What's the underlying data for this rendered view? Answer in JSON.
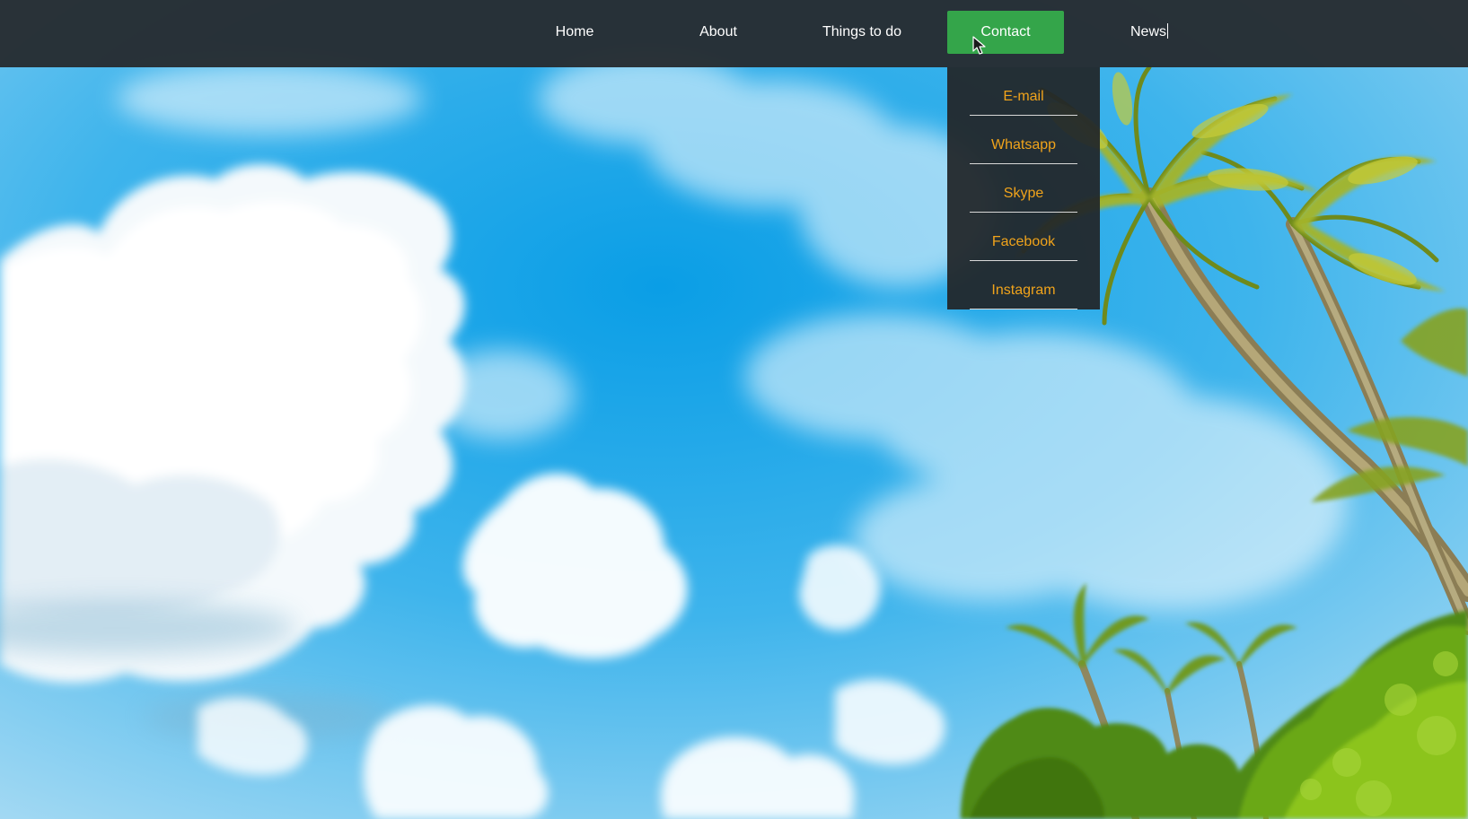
{
  "nav": {
    "items": [
      {
        "label": "Home"
      },
      {
        "label": "About"
      },
      {
        "label": "Things to do"
      },
      {
        "label": "Contact"
      },
      {
        "label": "News"
      }
    ]
  },
  "dropdown": {
    "items": [
      {
        "label": "E-mail"
      },
      {
        "label": "Whatsapp"
      },
      {
        "label": "Skype"
      },
      {
        "label": "Facebook"
      },
      {
        "label": "Instagram"
      }
    ]
  },
  "colors": {
    "navbar": "#262c30",
    "active_tab": "#34a54a",
    "dropdown_text": "#f0a31b",
    "sky": "#1aa3e6"
  },
  "icons": {
    "cursor": "arrow-cursor-icon"
  }
}
